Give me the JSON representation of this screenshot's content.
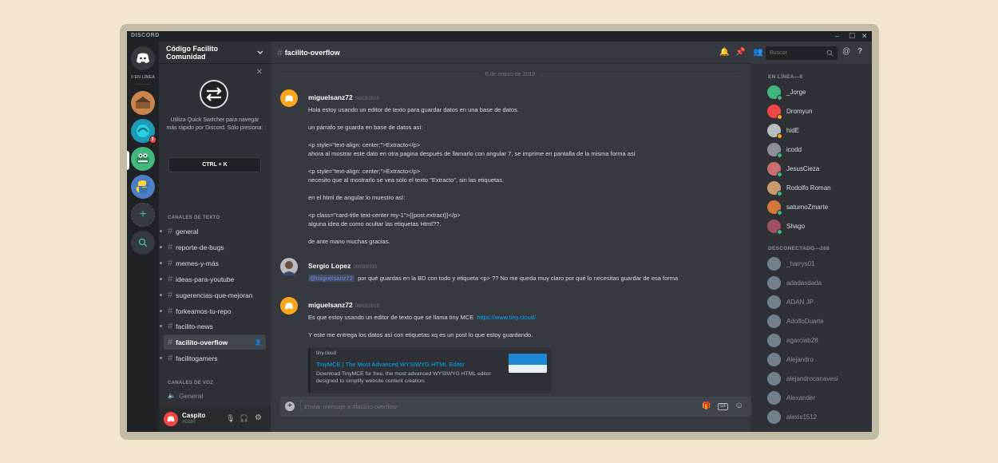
{
  "app": {
    "brand": "DISCORD",
    "window_controls": [
      "–",
      "☐",
      "✕"
    ]
  },
  "rail": {
    "online_label": "0 EN LÍNEA",
    "servers": [
      {
        "name": "server-1",
        "color": "#c8854f"
      },
      {
        "name": "server-2",
        "color": "#1e9bb4",
        "badge": "1"
      },
      {
        "name": "server-3",
        "color": "#43b581"
      },
      {
        "name": "server-4",
        "color": "#4e7ec4"
      }
    ]
  },
  "server": {
    "name": "Código Facilito Comunidad"
  },
  "quick_switcher": {
    "text": "Utiliza Quick Switcher para navegar más rápido por Discord. Sólo presiona:",
    "shortcut": "CTRL + K"
  },
  "text_category": "CANALES DE TEXTO",
  "channels": [
    {
      "label": "general"
    },
    {
      "label": "reporte-de-bugs"
    },
    {
      "label": "memes-y-más"
    },
    {
      "label": "ideas-para-youtube"
    },
    {
      "label": "sugerencias-que-mejoran"
    },
    {
      "label": "forkeamos-tu-repo"
    },
    {
      "label": "facilito-news"
    },
    {
      "label": "facilito-overflow",
      "selected": true
    },
    {
      "label": "facilitogamers"
    }
  ],
  "voice_category": "CANALES DE VOZ",
  "voice_channel": "General",
  "user": {
    "name": "Caspito",
    "tag": "#9389"
  },
  "main": {
    "channel": "facilito-overflow",
    "date_divider": "6 de marzo de 2019",
    "search_placeholder": "Buscar",
    "input_placeholder": "Enviar mensaje a #facilito-overflow"
  },
  "messages": [
    {
      "author": "miguelsanz72",
      "time": "06/03/2019",
      "avatar_color": "#faa61a",
      "lines": [
        "Hola estoy usando un editor de texto para guardar datos en una base de datos.",
        "",
        "un párrafo se guarda en base de datos así:",
        "",
        "<p style=\"text-align: center;\">Extracto</p>",
        "ahora al mostrar este dato en otra pagina después de llamarlo con angular 7, se imprime en pantalla de la misma forma así",
        "",
        "<p style=\"text-align: center;\">Extracto</p>",
        "necesito que al mostrarlo se vea solo el texto \"Extracto\", sin las etiquetas.",
        "",
        "en el html de angular lo muestro así:",
        "",
        "<p class=\"card-title text-center my-1\">{{post.extract}}</p>",
        "alguna idea de como ocultar las etiquetas Html??.",
        "",
        "de ante mano muchas gracias."
      ]
    },
    {
      "author": "Sergio Lopez",
      "time": "06/03/2019",
      "avatar_color": "#b9bbbe",
      "mention": "@miguelsanz72",
      "text": "por qué guardas en la BD con todo y etiqueta <p> ?? No me queda muy claro por qué lo necesitas guardar de esa forma"
    },
    {
      "author": "miguelsanz72",
      "time": "06/03/2019",
      "avatar_color": "#faa61a",
      "text": "Es que estoy usando un editor de texto que se llama tiny MCE",
      "link": "https://www.tiny.cloud/",
      "text2": "Y este me entrega los datos así con etiquetas xq es un post lo que estoy guardando.",
      "embed": {
        "provider": "tiny.cloud",
        "title": "TinyMCE | The Most Advanced WYSIWYG HTML Editor",
        "description": "Download TinyMCE for free, the most advanced WYSIWYG HTML editor designed to simplify website content creation."
      }
    }
  ],
  "members": {
    "online_header": "EN LÍNEA—8",
    "online": [
      {
        "name": "_Jorge",
        "color": "#43b581",
        "status": "#43b581"
      },
      {
        "name": "Dromyun",
        "color": "#f04747",
        "status": "#faa61a"
      },
      {
        "name": "hidE",
        "color": "#b9bbbe",
        "status": "#faa61a"
      },
      {
        "name": "icodd",
        "color": "#8e9297",
        "status": "#43b581"
      },
      {
        "name": "JesusCieza",
        "color": "#c86e6e",
        "status": "#43b581"
      },
      {
        "name": "Rodolfo Roman",
        "color": "#c89b6e",
        "status": "#43b581"
      },
      {
        "name": "saturnoZmarte",
        "color": "#d2783c",
        "status": "#43b581"
      },
      {
        "name": "Shago",
        "color": "#a05064",
        "status": "#43b581"
      }
    ],
    "offline_header": "DESCONECTADO—268",
    "offline": [
      {
        "name": "_harrys01"
      },
      {
        "name": "adadasdada"
      },
      {
        "name": "ADAN JP"
      },
      {
        "name": "AdolfoDuarte"
      },
      {
        "name": "agarciab28"
      },
      {
        "name": "Alejandro"
      },
      {
        "name": "alejandrocanavesi"
      },
      {
        "name": "Alexander"
      },
      {
        "name": "alexis1512"
      }
    ]
  }
}
